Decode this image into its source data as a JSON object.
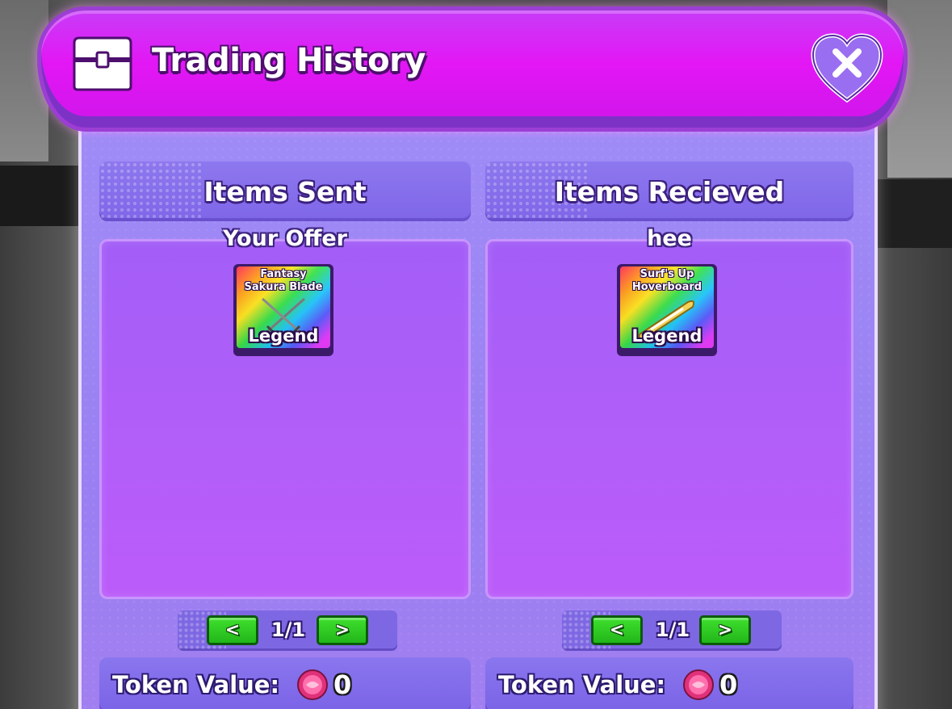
{
  "header": {
    "title": "Trading History",
    "icon": "chest-icon",
    "close_icon": "close-heart-icon"
  },
  "sent": {
    "title": "Items Sent",
    "owner": "Your Offer",
    "items": [
      {
        "name": "Fantasy Sakura Blade",
        "rarity": "Legend",
        "art": "crossed-swords-icon"
      }
    ],
    "pager": {
      "prev": "<",
      "count": "1/1",
      "next": ">"
    },
    "token": {
      "label": "Token Value:",
      "amount": "0",
      "icon": "pink-token-icon"
    }
  },
  "received": {
    "title": "Items Recieved",
    "owner": "hee",
    "items": [
      {
        "name": "Surf's Up Hoverboard",
        "rarity": "Legend",
        "art": "hoverboard-icon"
      }
    ],
    "pager": {
      "prev": "<",
      "count": "1/1",
      "next": ">"
    },
    "token": {
      "label": "Token Value:",
      "amount": "0",
      "icon": "pink-token-icon"
    }
  },
  "colors": {
    "header": "#e317f5",
    "panel": "#9a7ff2",
    "item_box": "#b25ef9",
    "pager_button": "#2fcb22",
    "token": "#ff5aa0"
  }
}
